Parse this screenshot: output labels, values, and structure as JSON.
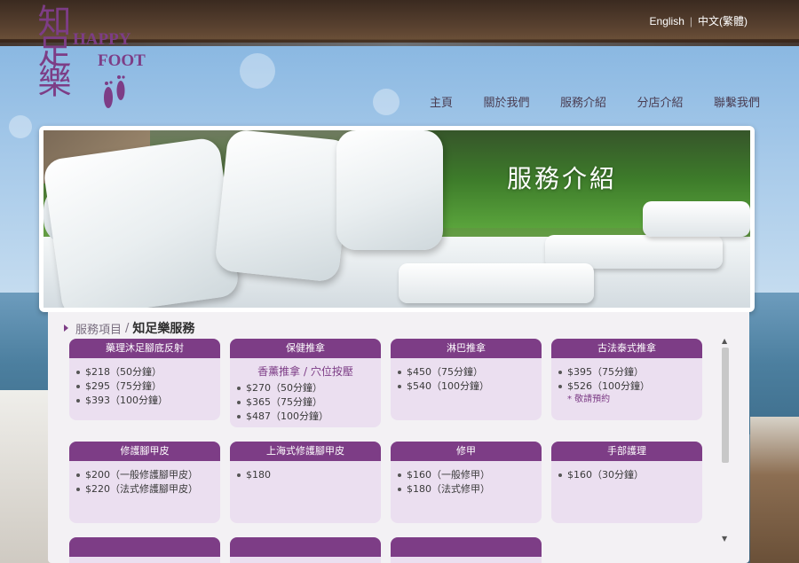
{
  "header": {
    "logo": {
      "cn": "知足樂",
      "en_line1": "HAPPY",
      "en_line2": "FOOT"
    },
    "lang": {
      "english": "English",
      "chinese": "中文(繁體)"
    },
    "nav": [
      "主頁",
      "關於我們",
      "服務介紹",
      "分店介紹",
      "聯繫我們"
    ]
  },
  "banner": {
    "title": "服務介紹"
  },
  "breadcrumb": {
    "section": "服務項目",
    "separator": "/",
    "current": "知足樂服務"
  },
  "cards": [
    {
      "title": "藥理沐足腳底反射",
      "items": [
        "$218（50分鐘）",
        "$295（75分鐘）",
        "$393（100分鐘）"
      ]
    },
    {
      "title": "保健推拿",
      "sub": "香薰推拿 / 穴位按壓",
      "items": [
        "$270（50分鐘）",
        "$365（75分鐘）",
        "$487（100分鐘）"
      ]
    },
    {
      "title": "淋巴推拿",
      "items": [
        "$450（75分鐘）",
        "$540（100分鐘）"
      ]
    },
    {
      "title": "古法泰式推拿",
      "items": [
        "$395（75分鐘）",
        "$526（100分鐘）"
      ],
      "note": "* 敬請預約"
    },
    {
      "title": "修護腳甲皮",
      "items": [
        "$200（一般修護腳甲皮）",
        "$220（法式修護腳甲皮）"
      ]
    },
    {
      "title": "上海式修護腳甲皮",
      "items": [
        "$180"
      ]
    },
    {
      "title": "修甲",
      "items": [
        "$160（一般修甲）",
        "$180（法式修甲）"
      ]
    },
    {
      "title": "手部護理",
      "items": [
        "$160（30分鐘）"
      ]
    }
  ],
  "colors": {
    "accent": "#7d3d86",
    "card_bg": "#ebdff0"
  },
  "scrollbar": {
    "up": "▲",
    "down": "▼"
  }
}
